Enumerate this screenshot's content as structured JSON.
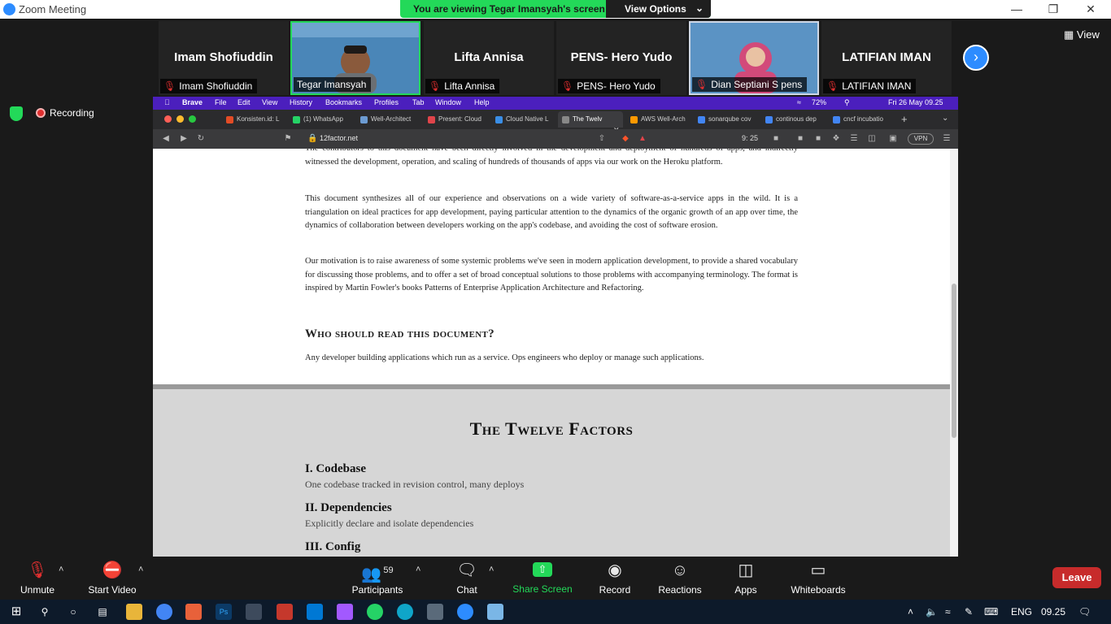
{
  "zoom": {
    "window_title": "Zoom Meeting",
    "viewing_banner": "You are viewing Tegar Imansyah's screen",
    "view_options": "View Options",
    "view_button": "View",
    "recording": "Recording",
    "participants_count": "59"
  },
  "gallery": [
    {
      "big": "Imam Shofiuddin",
      "label": "Imam Shofiuddin",
      "muted": true,
      "video": false
    },
    {
      "big": "",
      "label": "Tegar Imansyah",
      "muted": false,
      "video": true
    },
    {
      "big": "Lifta Annisa",
      "label": "Lifta Annisa",
      "muted": true,
      "video": false
    },
    {
      "big": "PENS- Hero Yudo",
      "label": "PENS- Hero Yudo",
      "muted": true,
      "video": false
    },
    {
      "big": "",
      "label": "Dian Septiani S pens",
      "muted": true,
      "video": true
    },
    {
      "big": "LATIFIAN IMAN",
      "label": "LATIFIAN IMAN",
      "muted": true,
      "video": false
    }
  ],
  "mac_menu": [
    "Brave",
    "File",
    "Edit",
    "View",
    "History",
    "Bookmarks",
    "Profiles",
    "Tab",
    "Window",
    "Help"
  ],
  "mac_status": {
    "battery": "72%",
    "datetime": "Fri 26 May  09.25"
  },
  "browser_tabs": [
    {
      "label": "Konsisten.id: L",
      "color": "#e34c26"
    },
    {
      "label": "(1) WhatsApp",
      "color": "#25d366"
    },
    {
      "label": "Well-Architect",
      "color": "#6c9bd2"
    },
    {
      "label": "Present: Cloud",
      "color": "#e0444a"
    },
    {
      "label": "Cloud Native L",
      "color": "#3a8ee6"
    },
    {
      "label": "The Twelv",
      "color": "#888888"
    },
    {
      "label": "AWS Well-Arch",
      "color": "#ff9900"
    },
    {
      "label": "sonarqube cov",
      "color": "#4285f4"
    },
    {
      "label": "continous dep",
      "color": "#4285f4"
    },
    {
      "label": "cncf incubatio",
      "color": "#4285f4"
    }
  ],
  "url": "12factor.net",
  "browser_badges": {
    "counter": "9: 25",
    "vpn": "VPN"
  },
  "doc": {
    "p0": "The contributors to this document have been directly involved in the development and deployment of hundreds of apps, and indirectly witnessed the development, operation, and scaling of hundreds of thousands of apps via our work on the Heroku platform.",
    "p1": "This document synthesizes all of our experience and observations on a wide variety of software-as-a-service apps in the wild. It is a triangulation on ideal practices for app development, paying particular attention to the dynamics of the organic growth of an app over time, the dynamics of collaboration between developers working on the app's codebase, and avoiding the cost of software erosion.",
    "p2": "Our motivation is to raise awareness of some systemic problems we've seen in modern application development, to provide a shared vocabulary for discussing those problems, and to offer a set of broad conceptual solutions to those problems with accompanying terminology. The format is inspired by Martin Fowler's books Patterns of Enterprise Application Architecture and Refactoring.",
    "who_heading": "Who should read this document?",
    "who_text": "Any developer building applications which run as a service. Ops engineers who deploy or manage such applications.",
    "twelve_heading": "The Twelve Factors",
    "factors": [
      {
        "title": "I. Codebase",
        "desc": "One codebase tracked in revision control, many deploys"
      },
      {
        "title": "II. Dependencies",
        "desc": "Explicitly declare and isolate dependencies"
      },
      {
        "title": "III. Config",
        "desc": ""
      }
    ]
  },
  "toolbar": {
    "unmute": "Unmute",
    "start_video": "Start Video",
    "participants": "Participants",
    "chat": "Chat",
    "share": "Share Screen",
    "record": "Record",
    "reactions": "Reactions",
    "apps": "Apps",
    "whiteboards": "Whiteboards",
    "leave": "Leave"
  },
  "taskbar": {
    "lang": "ENG",
    "time": "09.25"
  }
}
